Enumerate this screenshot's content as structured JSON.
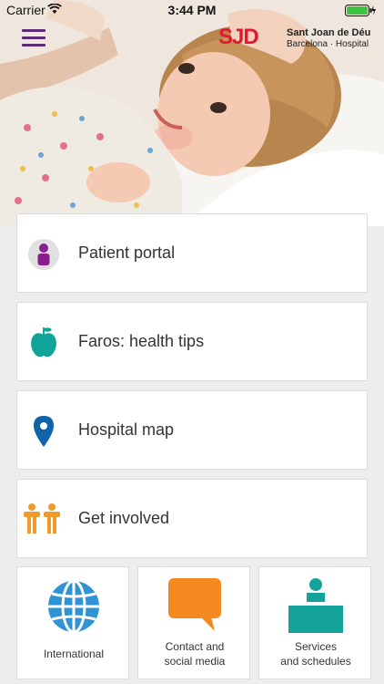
{
  "status_bar": {
    "carrier": "Carrier",
    "time": "3:44 PM"
  },
  "header": {
    "logo": {
      "mark": "SJD",
      "name": "Sant Joan de Déu",
      "subtitle": "Barcelona · Hospital"
    }
  },
  "menu": [
    {
      "label": "Patient portal",
      "icon": "person-icon",
      "color": "#8b1e8f"
    },
    {
      "label": "Faros: health tips",
      "icon": "apple-icon",
      "color": "#0fa39a"
    },
    {
      "label": "Hospital map",
      "icon": "map-pin-icon",
      "color": "#1063a8"
    },
    {
      "label": "Get involved",
      "icon": "people-icon",
      "color": "#f19a2c"
    }
  ],
  "tiles": [
    {
      "label": "International",
      "icon": "globe-icon",
      "color": "#2f93d6"
    },
    {
      "label": "Contact and\nsocial media",
      "icon": "speech-bubble-icon",
      "color": "#f4891f"
    },
    {
      "label": "Services\nand schedules",
      "icon": "reception-desk-icon",
      "color": "#13a39b"
    }
  ],
  "colors": {
    "menu_icon": "#5e2a77",
    "brand_red": "#e3182d"
  }
}
